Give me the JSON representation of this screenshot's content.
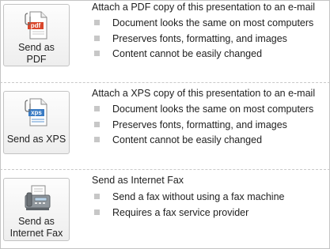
{
  "pdf": {
    "button_label": "Send as\nPDF",
    "icon_text": "pdf",
    "heading": "Attach a PDF copy of this presentation to an e-mail",
    "bullets": [
      "Document looks the same on most computers",
      "Preserves fonts, formatting, and images",
      "Content cannot be easily changed"
    ]
  },
  "xps": {
    "button_label": "Send as XPS",
    "icon_text": "xps",
    "heading": "Attach a XPS copy of this presentation to an e-mail",
    "bullets": [
      "Document looks the same on most computers",
      "Preserves fonts, formatting, and images",
      "Content cannot be easily changed"
    ]
  },
  "fax": {
    "button_label": "Send as\nInternet Fax",
    "heading": "Send as Internet Fax",
    "bullets": [
      "Send a fax without using a fax machine",
      "Requires a fax service provider"
    ]
  },
  "colors": {
    "pdf_accent": "#d9462b",
    "xps_accent": "#3b7cc4",
    "bullet_square": "#c7c7c7",
    "separator": "#c9c9c9"
  },
  "icons": [
    "pdf-document-icon",
    "xps-document-icon",
    "fax-machine-icon"
  ]
}
